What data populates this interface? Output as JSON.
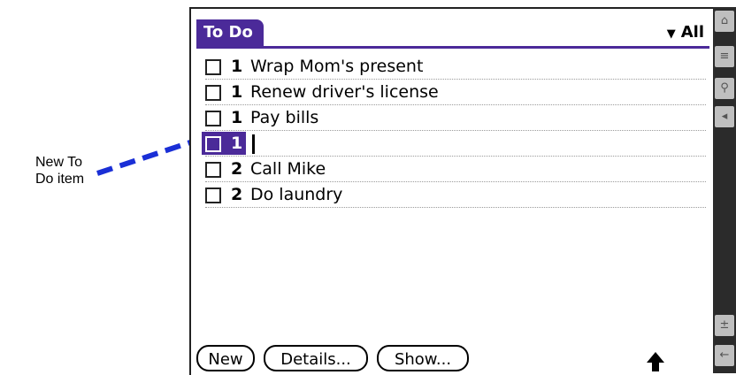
{
  "callout": {
    "line1": "New To",
    "line2": "Do item"
  },
  "app": {
    "title": "To Do",
    "category": "All",
    "category_icon": "triangle-down-icon"
  },
  "todos": [
    {
      "priority": "1",
      "text": "Wrap Mom's present",
      "checked": false
    },
    {
      "priority": "1",
      "text": "Renew driver's license",
      "checked": false
    },
    {
      "priority": "1",
      "text": "Pay bills",
      "checked": false
    },
    {
      "priority": "1",
      "text": "",
      "checked": false,
      "selected": true
    },
    {
      "priority": "2",
      "text": "Call Mike",
      "checked": false
    },
    {
      "priority": "2",
      "text": "Do laundry",
      "checked": false
    }
  ],
  "buttons": {
    "new": "New",
    "details": "Details...",
    "show": "Show..."
  },
  "colors": {
    "accent": "#4b2a99",
    "callout_line": "#1a2fd6"
  },
  "strip_icons": [
    "home-icon",
    "menu-icon",
    "find-icon",
    "speaker-icon",
    "calc-icon",
    "back-icon"
  ]
}
